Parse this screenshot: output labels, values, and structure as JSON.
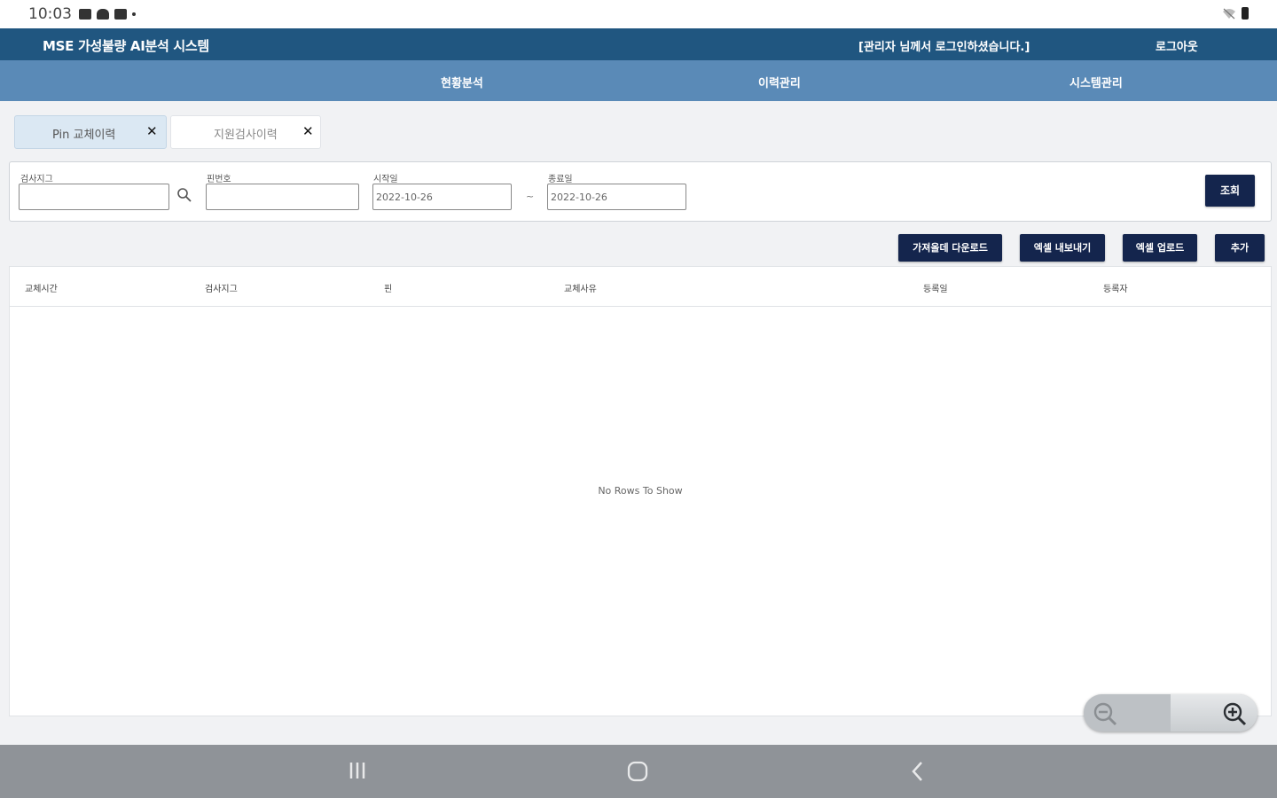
{
  "status_bar": {
    "time": "10:03"
  },
  "header": {
    "app_title": "MSE 가성불량 AI분석 시스템",
    "login_message": "[관리자 님께서 로그인하셨습니다.]",
    "logout_label": "로그아웃"
  },
  "nav": {
    "items": [
      {
        "label": "현황분석"
      },
      {
        "label": "이력관리"
      },
      {
        "label": "시스템관리"
      }
    ]
  },
  "tabs": [
    {
      "label": "Pin 교체이력"
    },
    {
      "label": "지원검사이력"
    }
  ],
  "search": {
    "fields": [
      {
        "label": "검사지그",
        "value": ""
      },
      {
        "label": "핀번호",
        "value": ""
      },
      {
        "label": "시작일",
        "value": "2022-10-26"
      },
      {
        "label": "종료일",
        "value": "2022-10-26"
      }
    ],
    "separator": "~",
    "query_button": "조회"
  },
  "actions": {
    "template_download": "가져올데 다운로드",
    "excel_export": "엑셀 내보내기",
    "excel_upload": "엑셀 업로드",
    "add": "추가"
  },
  "table": {
    "columns": [
      "교체시간",
      "검사지그",
      "핀",
      "교체사유",
      "등록일",
      "등록자"
    ],
    "empty_message": "No Rows To Show"
  },
  "colors": {
    "header_bg": "#205680",
    "nav_bg": "#5a8ab7",
    "button_bg": "#14254d",
    "active_tab_bg": "#dbe8f3"
  }
}
